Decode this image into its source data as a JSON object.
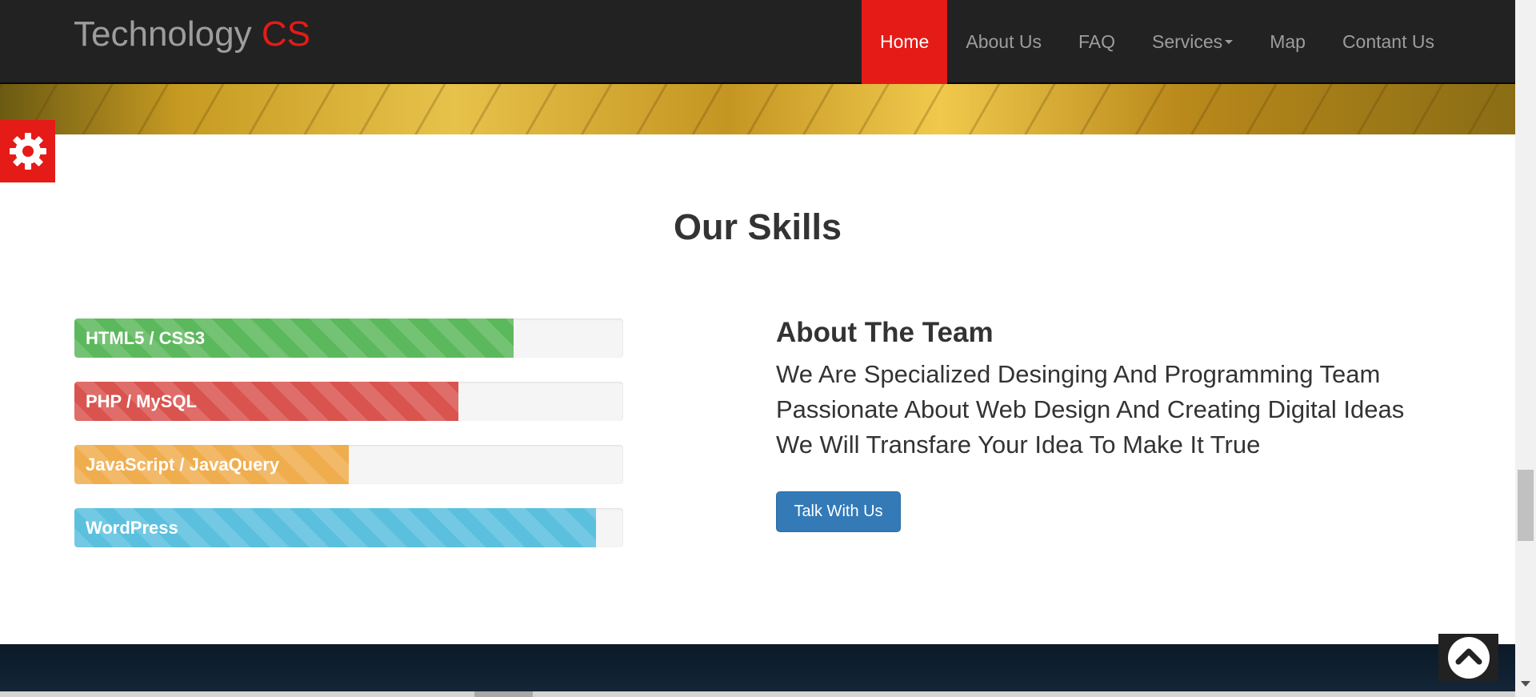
{
  "brand": {
    "name": "Technology",
    "accent": "CS"
  },
  "nav": {
    "home": "Home",
    "about": "About Us",
    "faq": "FAQ",
    "services": "Services",
    "map": "Map",
    "contact": "Contant Us"
  },
  "skills": {
    "title": "Our Skills",
    "items": [
      {
        "label": "HTML5 / CSS3",
        "percent": 80,
        "color": "#5cb85c"
      },
      {
        "label": "PHP / MySQL",
        "percent": 70,
        "color": "#d9534f"
      },
      {
        "label": "JavaScript / JavaQuery",
        "percent": 50,
        "color": "#f0ad4e"
      },
      {
        "label": "WordPress",
        "percent": 95,
        "color": "#5bc0de"
      }
    ]
  },
  "about": {
    "heading": "About The Team",
    "lines": [
      "We Are Specialized Desinging And Programming Team",
      "Passionate About Web Design And Creating Digital Ideas",
      "We Will Transfare Your Idea To Make It True"
    ],
    "button": "Talk With Us"
  },
  "icons": {
    "settings": "gear-icon",
    "scroll_top": "chevron-up-icon"
  },
  "colors": {
    "accent": "#e41b17",
    "navbar": "#222222",
    "primary_button": "#337ab7"
  },
  "scroll": {
    "vertical_position": 0.67
  }
}
